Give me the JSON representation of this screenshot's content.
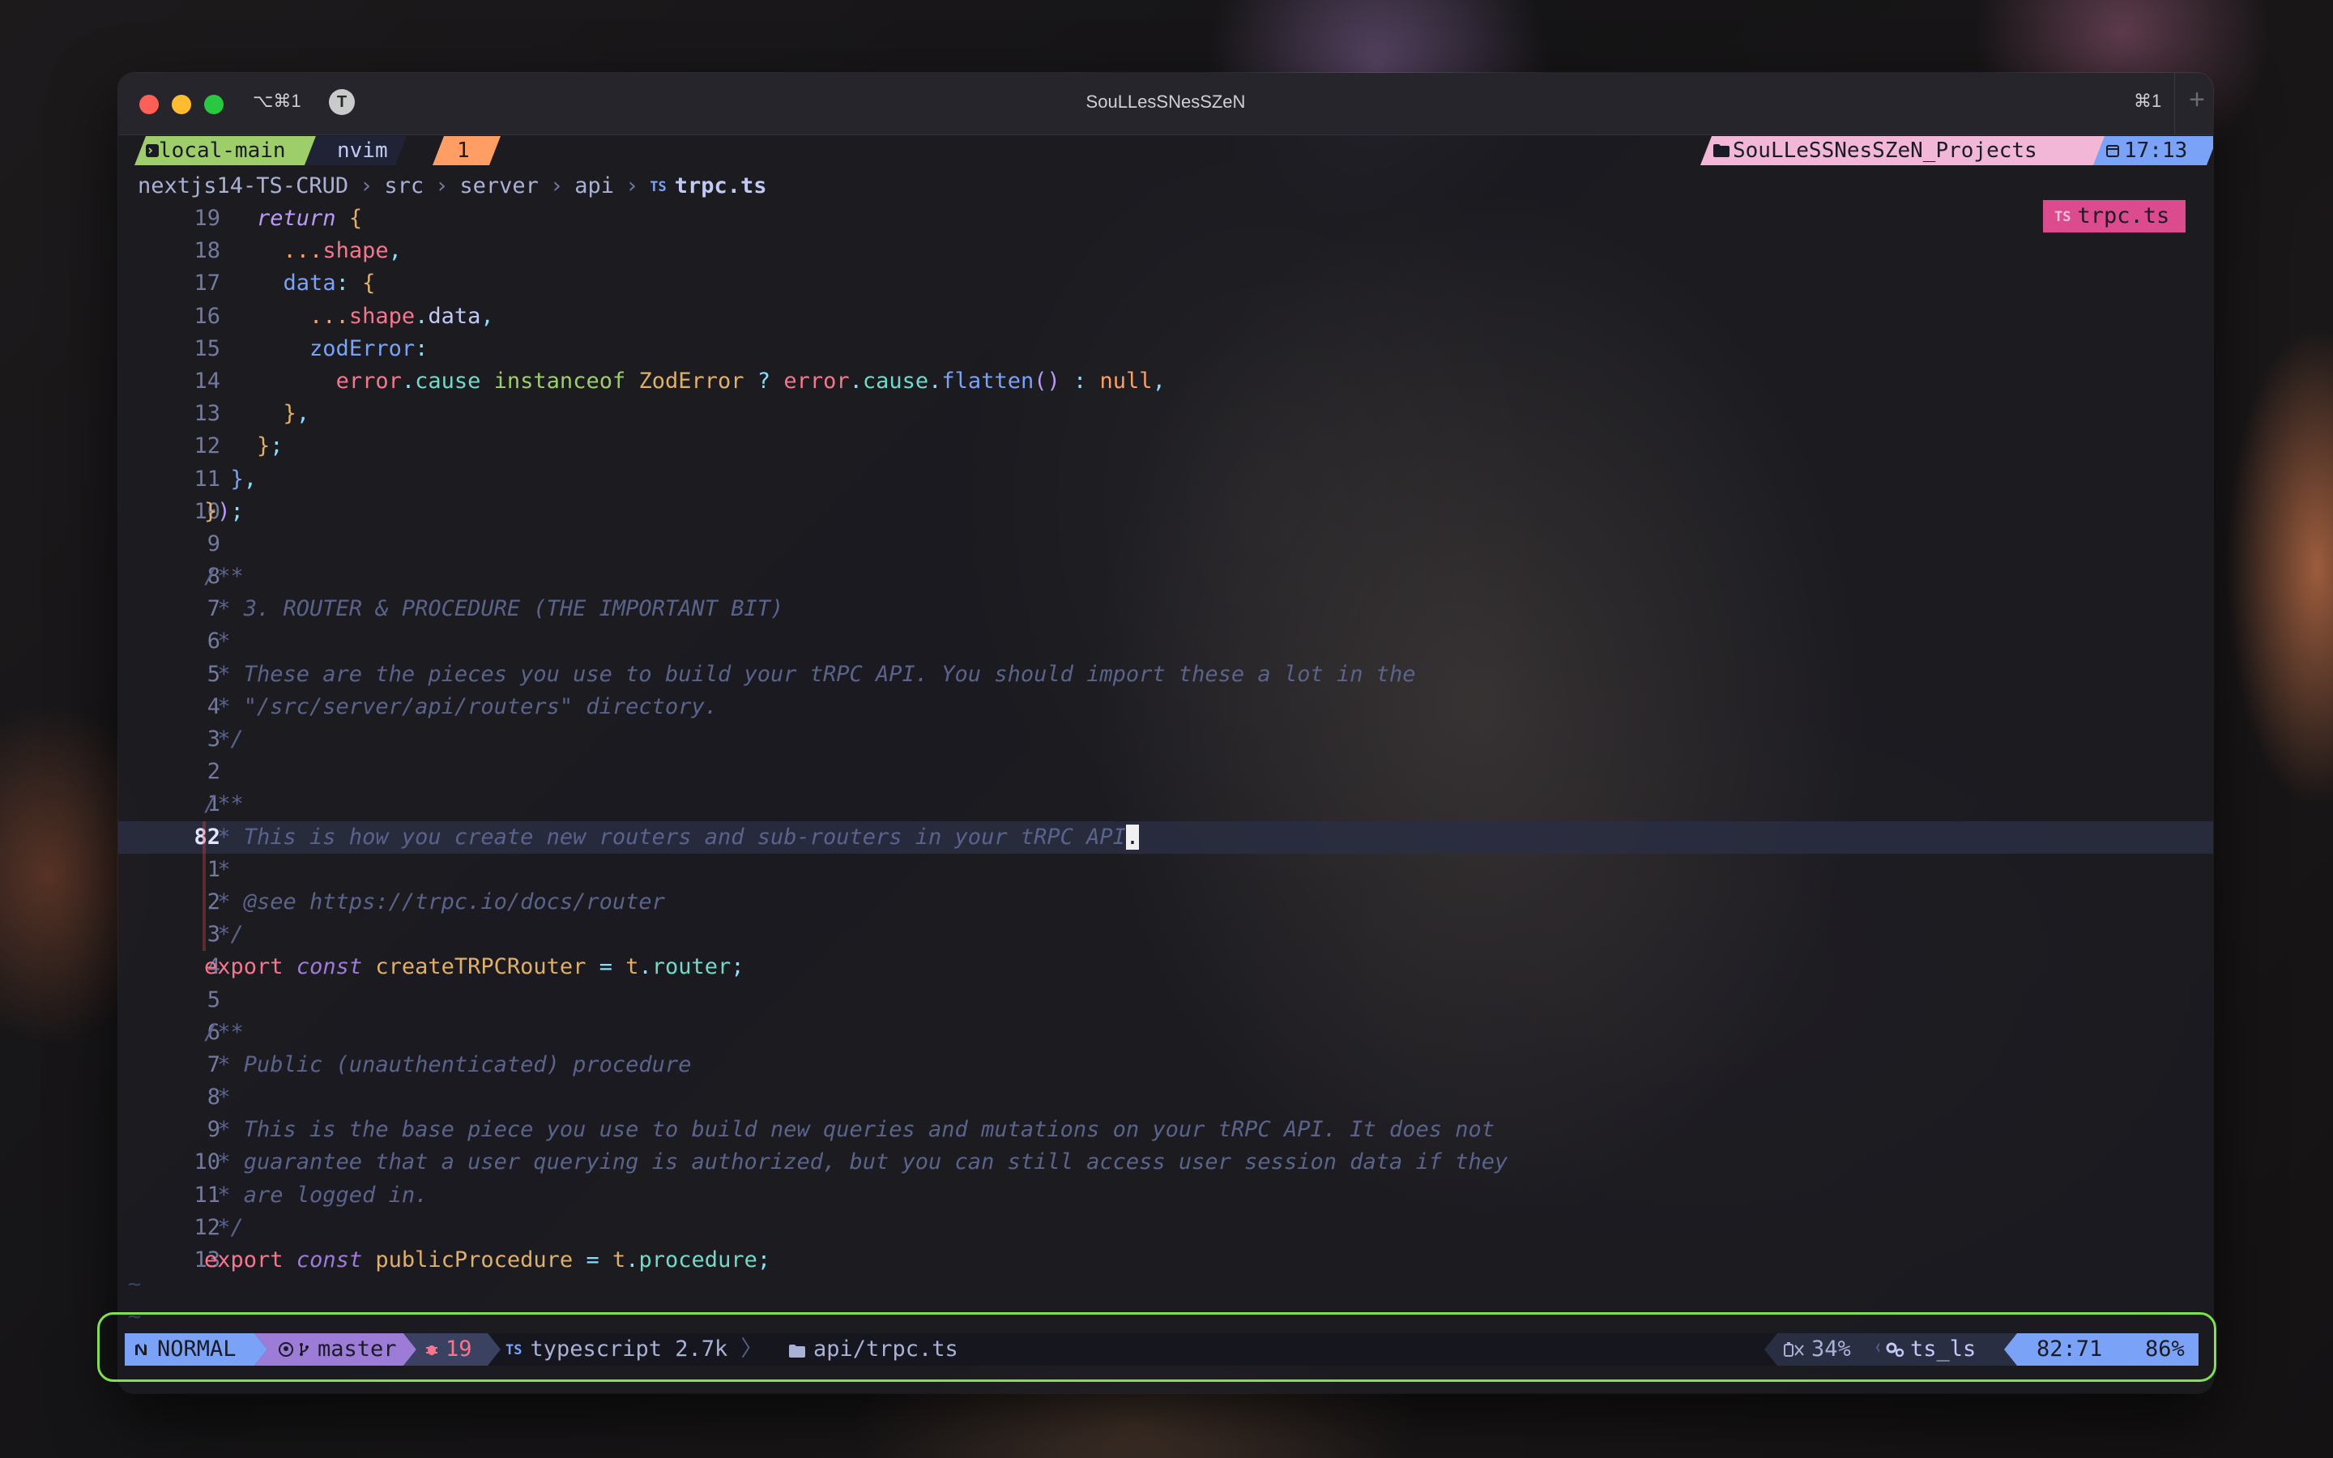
{
  "titlebar": {
    "shortcut_left": "⌥⌘1",
    "badge": "T",
    "title": "SouLLesSNesSZeN",
    "shortcut_right": "⌘1"
  },
  "tmux": {
    "session": "local-main",
    "window_name": "nvim",
    "window_index": "1",
    "project": "SouLLeSSNesSZeN_Projects",
    "time": "17:13"
  },
  "breadcrumb": {
    "parts": [
      "nextjs14-TS-CRUD",
      "src",
      "server",
      "api"
    ],
    "ts_icon": "TS",
    "file": "trpc.ts"
  },
  "file_tag": {
    "ts_icon": "TS",
    "label": "trpc.ts"
  },
  "editor": {
    "line_numbers": [
      "19",
      "18",
      "17",
      "16",
      "15",
      "14",
      "13",
      "12",
      "11",
      "10",
      "9",
      "8",
      "7",
      "6",
      "5",
      "4",
      "3",
      "2",
      "1",
      "82",
      "1",
      "2",
      "3",
      "4",
      "5",
      "6",
      "7",
      "8",
      "9",
      "10",
      "11",
      "12",
      "13"
    ],
    "comments": {
      "c8": "/**",
      "c7": " * 3. ROUTER & PROCEDURE (THE IMPORTANT BIT)",
      "c6": " *",
      "c5": " * These are the pieces you use to build your tRPC API. You should import these a lot in the",
      "c4": " * \"/src/server/api/routers\" directory.",
      "c3": " */",
      "c1": "/**",
      "cur": " * This is how you create new routers and sub-routers in your tRPC API",
      "cur_char": ".",
      "a1": " *",
      "a2": " * @see https://trpc.io/docs/router",
      "a3": " */",
      "a6": "/**",
      "a7": " * Public (unauthenticated) procedure",
      "a8": " *",
      "a9": " * This is the base piece you use to build new queries and mutations on your tRPC API. It does not",
      "a10": " * guarantee that a user querying is authorized, but you can still access user session data if they",
      "a11": " * are logged in.",
      "a12": " */"
    },
    "tokens": {
      "return": "return",
      "spread": "...",
      "shape": "shape",
      "data": "data",
      "zodError": "zodError",
      "error": "error",
      "cause": "cause",
      "instanceof": "instanceof",
      "ZodError": "ZodError",
      "flatten": "flatten",
      "null": "null",
      "export": "export",
      "const": "const",
      "createTRPCRouter": "createTRPCRouter",
      "t": "t",
      "router": "router",
      "publicProcedure": "publicProcedure",
      "procedure": "procedure"
    },
    "tilde": "~"
  },
  "statusline": {
    "mode": "NORMAL",
    "branch": "master",
    "diagnostics": "19",
    "filetype_icon": "TS",
    "filetype": "typescript 2.7k",
    "path": "api/trpc.ts",
    "battery": "34%",
    "lsp": "ts_ls",
    "position": "82:71",
    "percent": "86%"
  },
  "colors": {
    "accent_blue": "#7aa2f7",
    "accent_green": "#9ece6a",
    "accent_orange": "#ff9e64",
    "accent_purple": "#9d7cd8",
    "accent_pink": "#db4b8e",
    "frame_green": "#80e14e"
  },
  "icons": [
    "terminal-icon",
    "folder-icon",
    "calendar-icon",
    "neovim-icon",
    "github-icon",
    "git-branch-icon",
    "bug-icon",
    "typescript-icon",
    "battery-icon",
    "gear-icon"
  ]
}
